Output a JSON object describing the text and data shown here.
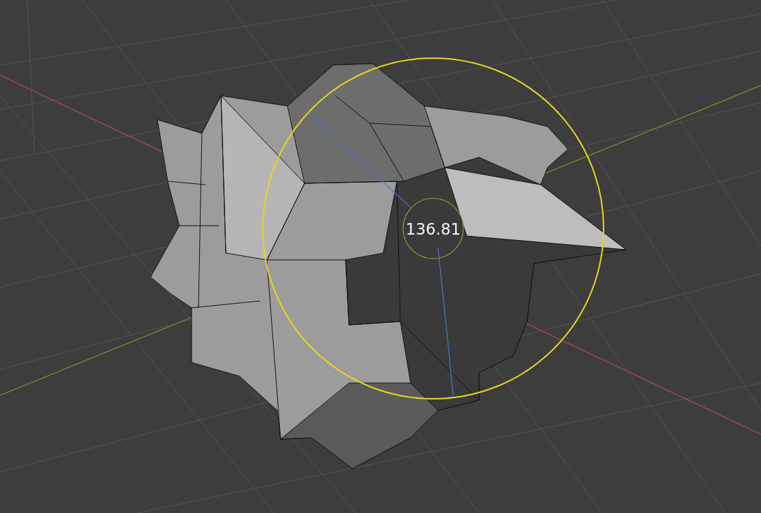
{
  "viewport": {
    "readout": "136.81"
  }
}
